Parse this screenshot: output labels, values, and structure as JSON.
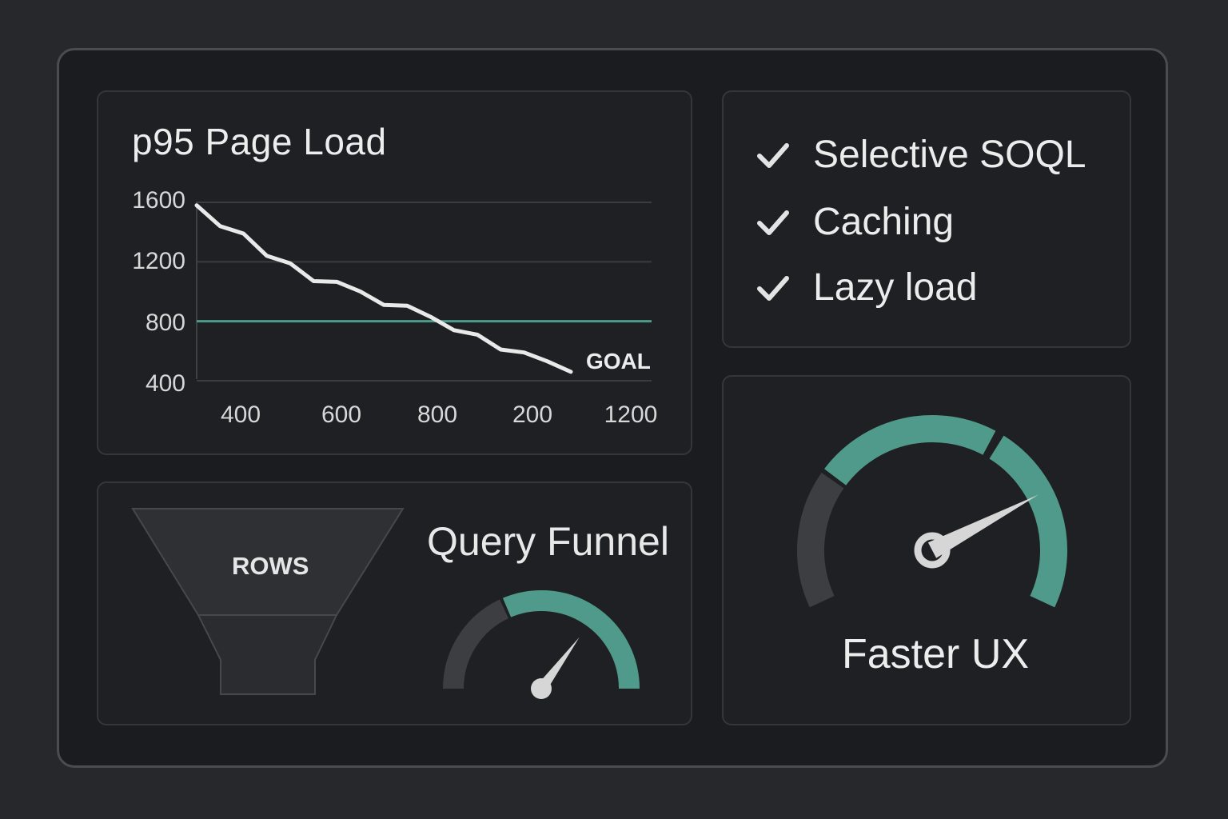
{
  "chart_data": {
    "type": "line",
    "title": "p95 Page Load",
    "x_tick_labels": [
      "400",
      "600",
      "800",
      "200",
      "1200"
    ],
    "y_ticks": [
      1600,
      1200,
      800,
      400
    ],
    "ylim": [
      400,
      1600
    ],
    "grid": true,
    "series": [
      {
        "color": "#e9e9e9",
        "values": [
          1580,
          1440,
          1390,
          1240,
          1190,
          1070,
          1065,
          1000,
          910,
          905,
          830,
          740,
          710,
          610,
          590,
          530,
          460
        ]
      }
    ],
    "goal": {
      "label": "GOAL",
      "value": 800,
      "color": "#4f9a8a"
    }
  },
  "checklist": {
    "items": [
      {
        "label": "Selective SOQL",
        "icon": "check-icon"
      },
      {
        "label": "Caching",
        "icon": "check-icon"
      },
      {
        "label": "Lazy load",
        "icon": "check-icon"
      }
    ]
  },
  "funnel_panel": {
    "title": "Query Funnel",
    "funnel_label": "ROWS",
    "gauge_level": 0.72
  },
  "ux_panel": {
    "label": "Faster UX",
    "gauge_level": 0.78
  },
  "colors": {
    "accent": "#4f9a8a",
    "gauge_track": "#3c3e42",
    "needle": "#d6d6d6"
  }
}
